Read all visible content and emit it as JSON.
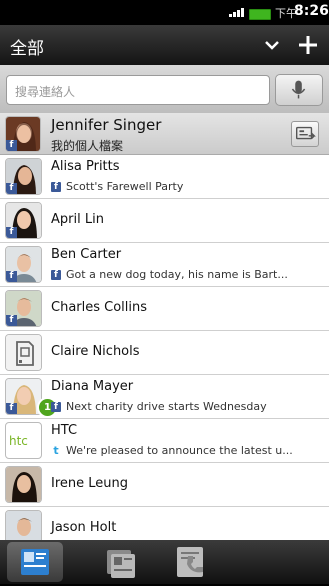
{
  "status": {
    "ampm": "下午",
    "time": "8:26"
  },
  "header": {
    "title": "全部"
  },
  "search": {
    "placeholder": "搜尋連絡人"
  },
  "me": {
    "name": "Jennifer Singer",
    "subtitle": "我的個人檔案"
  },
  "contacts": [
    {
      "name": "Alisa Pritts",
      "status": "Scott's Farewell Party",
      "source": "facebook"
    },
    {
      "name": "April Lin"
    },
    {
      "name": "Ben Carter",
      "status": "Got a new dog today, his name is Bart...",
      "source": "facebook"
    },
    {
      "name": "Charles Collins"
    },
    {
      "name": "Claire Nichols"
    },
    {
      "name": "Diana Mayer",
      "status": "Next charity drive starts Wednesday",
      "source": "facebook",
      "badge": "1"
    },
    {
      "name": "HTC",
      "status": "We're pleased to announce the latest u...",
      "source": "twitter",
      "avatar_text": "htc"
    },
    {
      "name": "Irene Leung"
    },
    {
      "name": "Jason Holt"
    }
  ],
  "tabs": [
    {
      "id": "people",
      "icon": "people-icon",
      "selected": true
    },
    {
      "id": "groups",
      "icon": "groups-icon",
      "selected": false
    },
    {
      "id": "call-history",
      "icon": "call-history-icon",
      "selected": false
    }
  ]
}
